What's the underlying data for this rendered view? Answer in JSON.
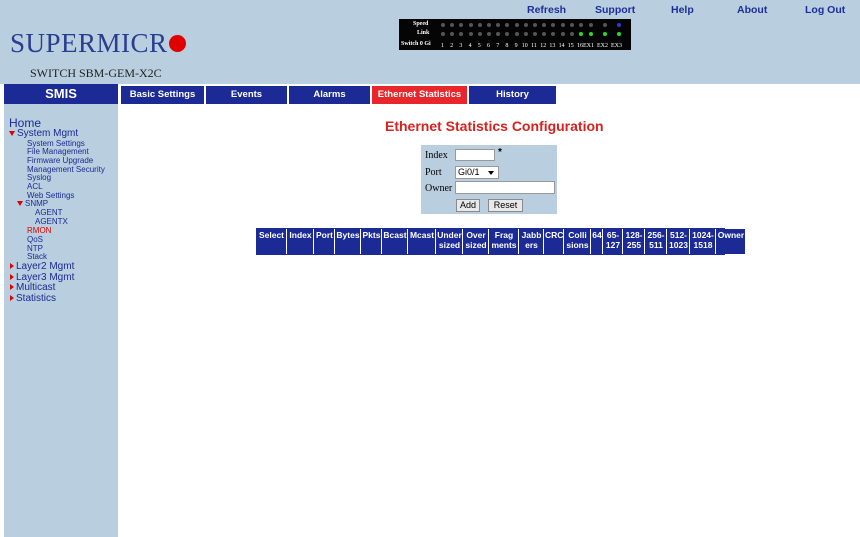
{
  "header": {
    "logo_text": "SUPERMICR",
    "model": "SWITCH SBM-GEM-X2C",
    "links": [
      "Refresh",
      "Support",
      "Help",
      "About",
      "Log Out"
    ]
  },
  "led_panel": {
    "speed_label": "Speed",
    "link_label": "Link",
    "switch_label": "Switch 0 Gi",
    "ports": [
      "1",
      "2",
      "3",
      "4",
      "5",
      "6",
      "7",
      "8",
      "9",
      "10",
      "11",
      "12",
      "13",
      "14",
      "15",
      "16",
      "EX1",
      "EX2",
      "EX3"
    ]
  },
  "nav": {
    "smis": "SMIS",
    "tabs": [
      "Basic Settings",
      "Events",
      "Alarms",
      "Ethernet Statistics",
      "History"
    ],
    "active_tab": "Ethernet Statistics"
  },
  "sidebar": {
    "home": "Home",
    "system_mgmt": "System Mgmt",
    "system_items": [
      "System Settings",
      "File Management",
      "Firmware Upgrade",
      "Management Security",
      "Syslog",
      "ACL",
      "Web Settings"
    ],
    "snmp": "SNMP",
    "snmp_items": [
      "AGENT",
      "AGENTX"
    ],
    "rmon": "RMON",
    "other_items": [
      "QoS",
      "NTP",
      "Stack"
    ],
    "groups": [
      "Layer2 Mgmt",
      "Layer3 Mgmt",
      "Multicast",
      "Statistics"
    ]
  },
  "main": {
    "title": "Ethernet Statistics Configuration",
    "form": {
      "index_label": "Index",
      "index_value": "",
      "required_mark": "*",
      "port_label": "Port",
      "port_value": "Gi0/1",
      "owner_label": "Owner",
      "owner_value": "",
      "add_label": "Add",
      "reset_label": "Reset"
    },
    "table_headers": [
      [
        "Select"
      ],
      [
        "Index"
      ],
      [
        "Port"
      ],
      [
        "Bytes"
      ],
      [
        "Pkts"
      ],
      [
        "Bcast"
      ],
      [
        "Mcast"
      ],
      [
        "Under",
        "sized"
      ],
      [
        "Over",
        "sized"
      ],
      [
        "Frag",
        "ments"
      ],
      [
        "Jabb",
        "ers"
      ],
      [
        "CRC"
      ],
      [
        "Colli",
        "sions"
      ],
      [
        "64"
      ],
      [
        "65-",
        "127"
      ],
      [
        "128-",
        "255"
      ],
      [
        "256-",
        "511"
      ],
      [
        "512-",
        "1023"
      ],
      [
        "1024-",
        "1518"
      ],
      [
        "Owner"
      ]
    ]
  },
  "colors": {
    "navy": "#1b2a94",
    "accent_red": "#e8262b",
    "panel_blue": "#b9cede"
  }
}
